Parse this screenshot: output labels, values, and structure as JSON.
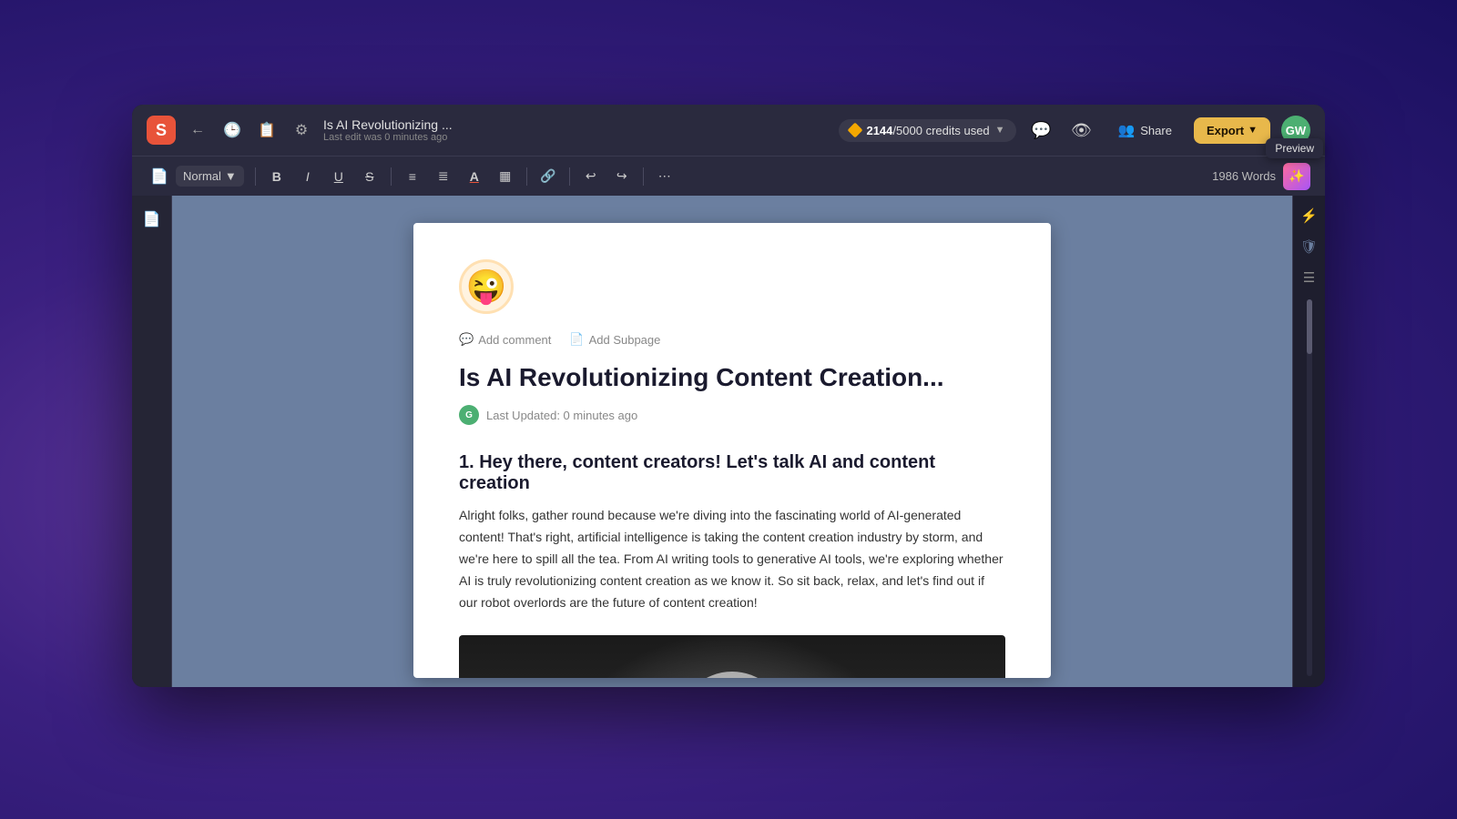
{
  "app": {
    "logo": "S",
    "title": "Is AI Revolutionizing ...",
    "subtitle": "Last edit was 0 minutes ago"
  },
  "credits": {
    "used": "2144",
    "total": "5000",
    "label": "credits used"
  },
  "toolbar": {
    "style_select": "Normal",
    "word_count": "1986 Words",
    "buttons": {
      "bold": "B",
      "italic": "I",
      "underline": "U",
      "strikethrough": "S",
      "bullet_list": "≡",
      "align": "≡",
      "text_color": "A",
      "highlight": "▣",
      "link": "🔗",
      "undo": "↩",
      "redo": "↪",
      "more": "⋯"
    }
  },
  "header_buttons": {
    "share": "Share",
    "export": "Export",
    "user_initials": "GW"
  },
  "preview_tooltip": "Preview",
  "document": {
    "emoji": "😜",
    "add_comment": "Add comment",
    "add_subpage": "Add Subpage",
    "title": "Is AI Revolutionizing Content Creation...",
    "last_updated": "Last Updated: 0 minutes ago",
    "author_initial": "G",
    "section1_heading": "1. Hey there, content creators! Let's talk AI and content creation",
    "section1_body": "Alright folks, gather round because we're diving into the fascinating world of AI-generated content! That's right, artificial intelligence is taking the content creation industry by storm, and we're here to spill all the tea. From AI writing tools to generative AI tools, we're exploring whether AI is truly revolutionizing content creation as we know it. So sit back, relax, and let's find out if our robot overlords are the future of content creation!"
  },
  "right_sidebar": {
    "icon1": "⚡",
    "icon2": "🛡",
    "icon3": "≡"
  }
}
